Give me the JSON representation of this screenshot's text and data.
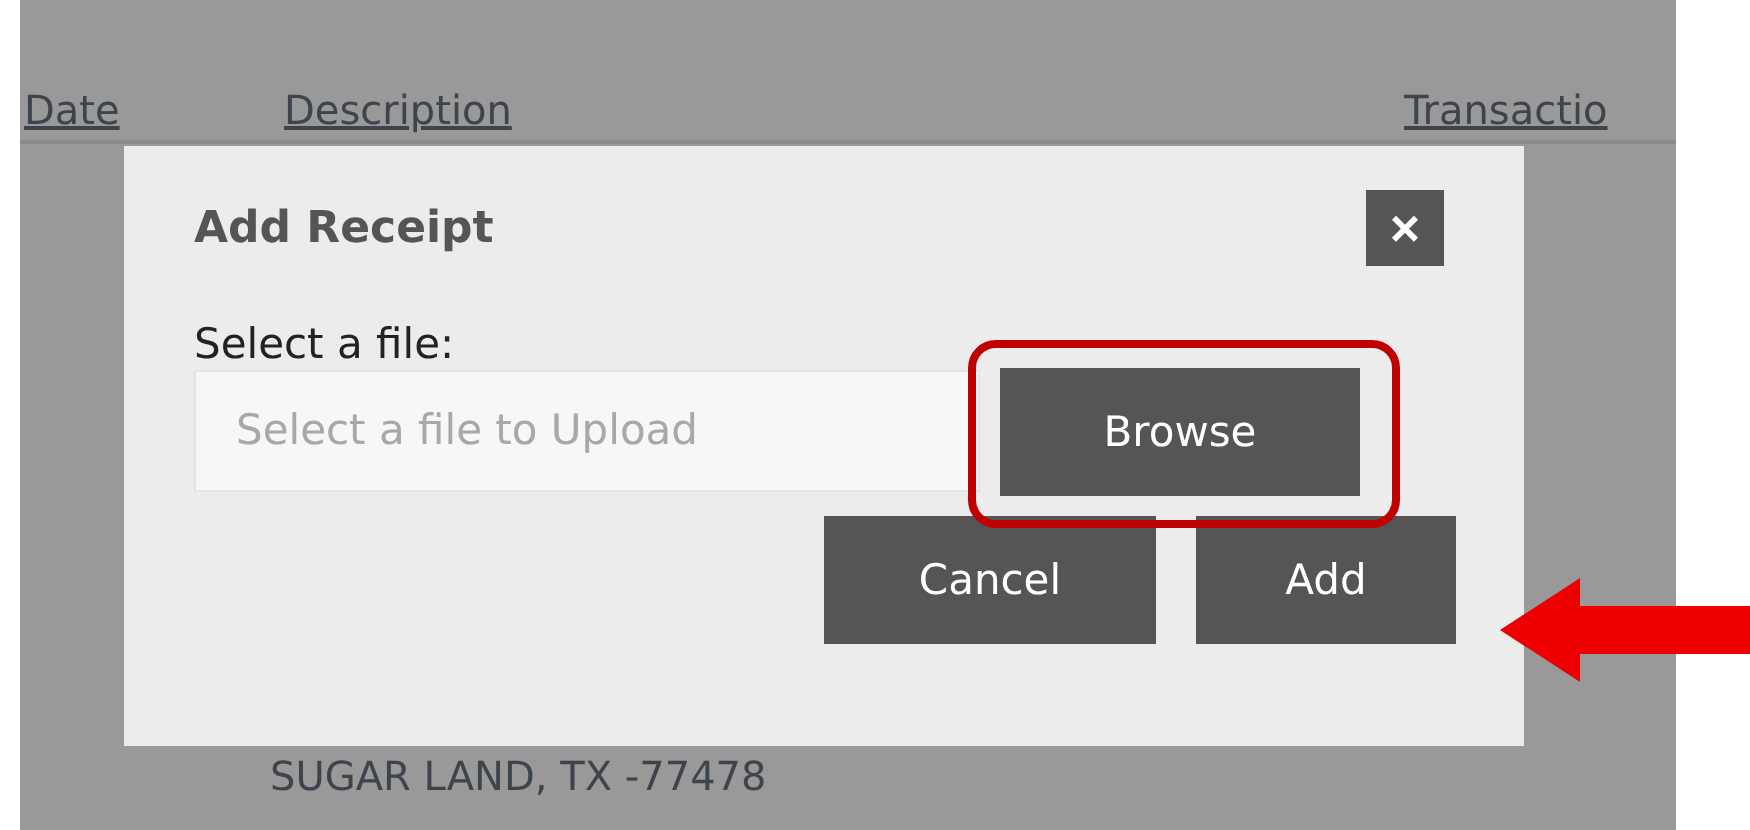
{
  "background_table": {
    "columns": [
      "Date",
      "Description",
      "Transactio"
    ],
    "address": "SUGAR LAND, TX -77478"
  },
  "dialog": {
    "title": "Add Receipt",
    "close": "×",
    "field_label": "Select a file:",
    "file_field": {
      "placeholder": "Select a file to Upload"
    },
    "browse_button": "Browse",
    "buttons": [
      "Cancel",
      "Add"
    ]
  },
  "annotations": {
    "browse_highlighted": true,
    "add_arrow": true
  }
}
